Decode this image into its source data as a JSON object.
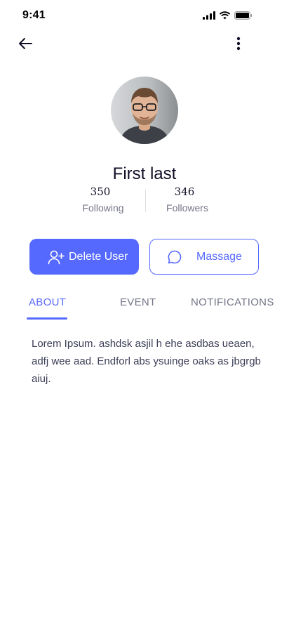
{
  "status_bar": {
    "time": "9:41",
    "icons": [
      "cellular-signal-icon",
      "wifi-icon",
      "battery-icon"
    ]
  },
  "top_bar": {
    "back_icon": "arrow-left-icon",
    "menu_icon": "more-vertical-icon"
  },
  "profile": {
    "name": "First last",
    "avatar": "profile-photo",
    "stats": {
      "following_value": "350",
      "following_label": "Following",
      "followers_value": "346",
      "followers_label": "Followers"
    }
  },
  "actions": {
    "delete_label": "Delete User",
    "delete_icon": "user-plus-icon",
    "message_label": "Massage",
    "message_icon": "chat-bubble-icon"
  },
  "tabs": [
    {
      "label": "ABOUT",
      "active": true
    },
    {
      "label": "EVENT",
      "active": false
    },
    {
      "label": "NOTIFICATIONS",
      "active": false
    }
  ],
  "about": {
    "text": "Lorem Ipsum. ashdsk asjil h ehe asdbas ueaen, adfj wee aad. Endforl abs ysuinge oaks as jbgrgb aiuj."
  },
  "colors": {
    "accent": "#5669ff",
    "text_primary": "#120d26",
    "text_secondary": "#747688",
    "body_text": "#3c3e56",
    "background": "#ffffff"
  }
}
